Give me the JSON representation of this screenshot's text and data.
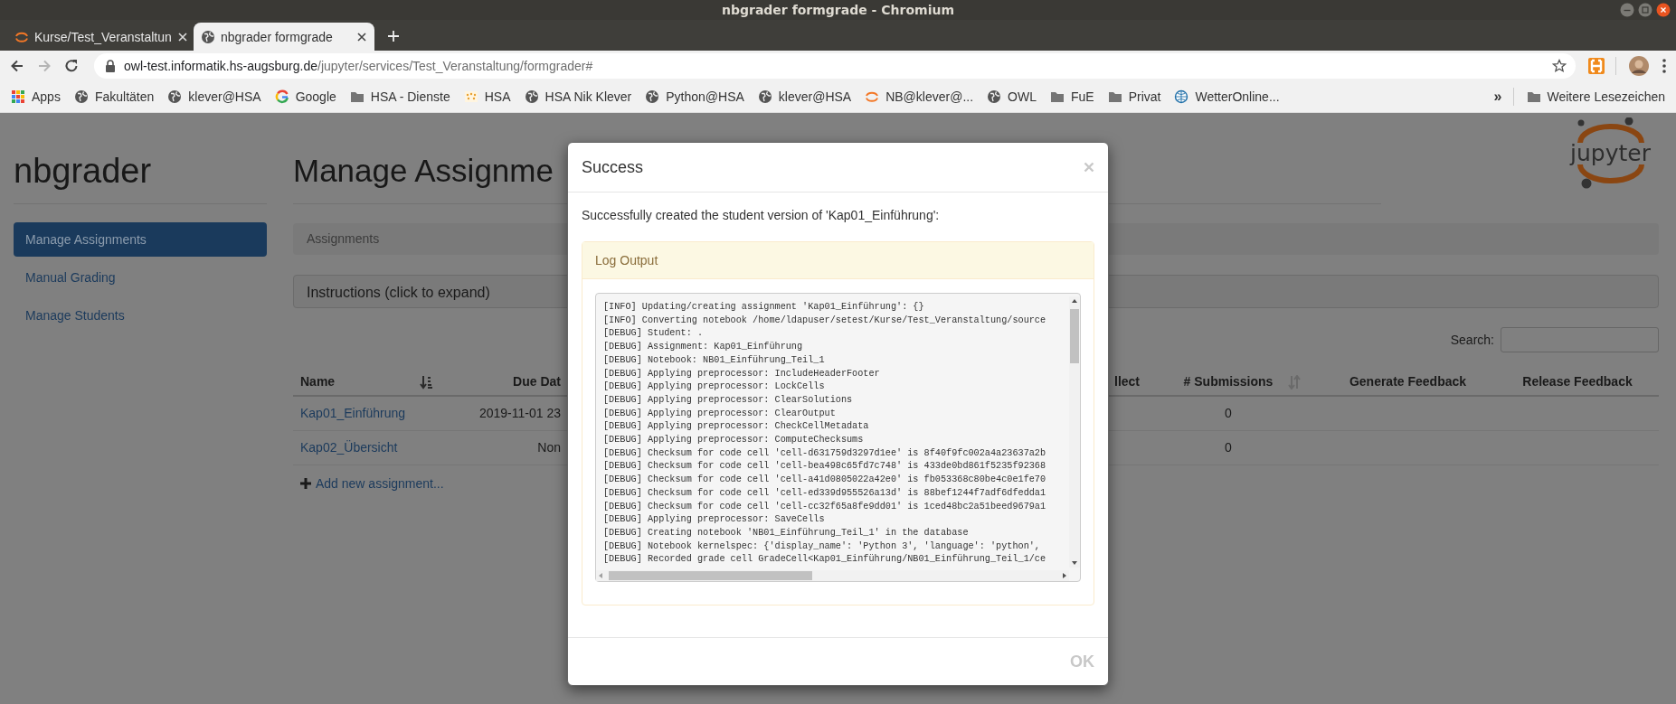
{
  "window": {
    "title": "nbgrader formgrade - Chromium"
  },
  "tabs": [
    {
      "title": "Kurse/Test_Veranstaltun",
      "kind": "jupyter",
      "selected": false
    },
    {
      "title": "nbgrader formgrade",
      "kind": "globe",
      "selected": true
    }
  ],
  "nav_buttons": [
    {
      "kind": "back",
      "disabled": false
    },
    {
      "kind": "forward",
      "disabled": true
    },
    {
      "kind": "reload",
      "disabled": false
    }
  ],
  "address_bar": {
    "host": "owl-test.informatik.hs-augsburg.de",
    "path": "/jupyter/services/Test_Veranstaltung/formgrader#"
  },
  "bookmarks": [
    {
      "kind": "apps",
      "label": "Apps"
    },
    {
      "kind": "globe",
      "label": "Fakultäten"
    },
    {
      "kind": "globe",
      "label": "klever@HSA"
    },
    {
      "kind": "google",
      "label": "Google"
    },
    {
      "kind": "folder",
      "label": "HSA - Dienste"
    },
    {
      "kind": "hsa",
      "label": "HSA"
    },
    {
      "kind": "globe",
      "label": "HSA Nik Klever"
    },
    {
      "kind": "globe",
      "label": "Python@HSA"
    },
    {
      "kind": "globe",
      "label": "klever@HSA"
    },
    {
      "kind": "jupyter",
      "label": "NB@klever@..."
    },
    {
      "kind": "globe",
      "label": "OWL"
    },
    {
      "kind": "folder",
      "label": "FuE"
    },
    {
      "kind": "folder",
      "label": "Privat"
    },
    {
      "kind": "weather",
      "label": "WetterOnline..."
    }
  ],
  "bookmarks_overflow": "»",
  "other_bookmarks": {
    "kind": "folder",
    "label": "Weitere Lesezeichen"
  },
  "page": {
    "brand": "nbgrader",
    "nav": [
      {
        "label": "Manage Assignments",
        "selected": true
      },
      {
        "label": "Manual Grading",
        "selected": false
      },
      {
        "label": "Manage Students",
        "selected": false
      }
    ],
    "heading": "Manage Assignme",
    "logo_text": "jupyter",
    "breadcrumb": "Assignments",
    "instructions": "Instructions (click to expand)",
    "search_label": "Search:",
    "table": {
      "columns": [
        {
          "label": "Name",
          "kind": "sorted_asc"
        },
        {
          "label": "Due Dat"
        },
        {
          "label": "llect"
        },
        {
          "label": "# Submissions",
          "kind": "sortable"
        },
        {
          "label": "Generate Feedback"
        },
        {
          "label": "Release Feedback"
        }
      ],
      "rows": [
        {
          "name": "Kap01_Einführung",
          "due_date": "2019-11-01 23",
          "submissions": "0"
        },
        {
          "name": "Kap02_Übersicht",
          "due_date": "Non",
          "submissions": "0"
        }
      ]
    },
    "add_link": "Add new assignment..."
  },
  "modal": {
    "title": "Success",
    "message": "Successfully created the student version of 'Kap01_Einführung':",
    "log_panel": {
      "title": "Log Output",
      "lines": [
        "[INFO] Updating/creating assignment 'Kap01_Einführung': {}",
        "[INFO] Converting notebook /home/ldapuser/setest/Kurse/Test_Veranstaltung/source",
        "[DEBUG] Student: .",
        "[DEBUG] Assignment: Kap01_Einführung",
        "[DEBUG] Notebook: NB01_Einführung_Teil_1",
        "[DEBUG] Applying preprocessor: IncludeHeaderFooter",
        "[DEBUG] Applying preprocessor: LockCells",
        "[DEBUG] Applying preprocessor: ClearSolutions",
        "[DEBUG] Applying preprocessor: ClearOutput",
        "[DEBUG] Applying preprocessor: CheckCellMetadata",
        "[DEBUG] Applying preprocessor: ComputeChecksums",
        "[DEBUG] Checksum for code cell 'cell-d631759d3297d1ee' is 8f40f9fc002a4a23637a2b",
        "[DEBUG] Checksum for code cell 'cell-bea498c65fd7c748' is 433de0bd861f5235f92368",
        "[DEBUG] Checksum for code cell 'cell-a41d0805022a42e0' is fb053368c80be4c0e1fe70",
        "[DEBUG] Checksum for code cell 'cell-ed339d955526a13d' is 88bef1244f7adf6dfedda1",
        "[DEBUG] Checksum for code cell 'cell-cc32f65a8fe9dd01' is 1ced48bc2a51beed9679a1",
        "[DEBUG] Applying preprocessor: SaveCells",
        "[DEBUG] Creating notebook 'NB01_Einführung_Teil_1' in the database",
        "[DEBUG] Notebook kernelspec: {'display_name': 'Python 3', 'language': 'python',",
        "[DEBUG] Recorded grade cell GradeCell<Kap01_Einführung/NB01_Einführung_Teil_1/ce"
      ]
    },
    "ok_button": "OK"
  }
}
